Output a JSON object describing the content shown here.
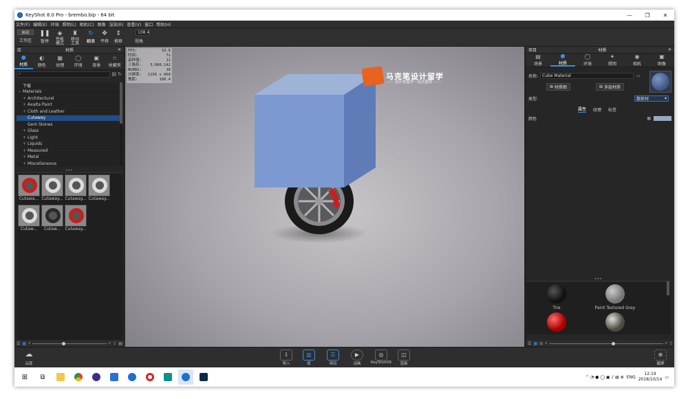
{
  "window": {
    "title": "KeyShot 8.0 Pro  -  brembo.bip  -  64 bit",
    "min": "—",
    "max": "❐",
    "close": "✕"
  },
  "menu": [
    "文件(F)",
    "编辑(E)",
    "环境",
    "照明(L)",
    "相机(C)",
    "图像",
    "渲染(R)",
    "查看(V)",
    "窗口",
    "帮助(H)"
  ],
  "toolbar": {
    "launch": "启动",
    "workspace": "工作区",
    "pause": "暂停",
    "perf_mode": "性能\n模式",
    "move_tool": "移动\n工具",
    "tumble": "翻滚",
    "pan": "平移",
    "dolly": "推移",
    "fov_value": "108.4",
    "fov_label": "视角"
  },
  "left_panel": {
    "title": "材质",
    "section": "库",
    "tabs": [
      {
        "label": "材质",
        "icon": "material-icon"
      },
      {
        "label": "颜色",
        "icon": "color-icon"
      },
      {
        "label": "纹理",
        "icon": "texture-icon"
      },
      {
        "label": "环境",
        "icon": "environment-icon"
      },
      {
        "label": "背景",
        "icon": "background-icon"
      },
      {
        "label": "收藏夹",
        "icon": "favorites-icon"
      }
    ],
    "tree": [
      {
        "label": "下载",
        "level": 0,
        "sel": false,
        "plus": ""
      },
      {
        "label": "Materials",
        "level": 0,
        "sel": false,
        "plus": "−"
      },
      {
        "label": "Architectural",
        "level": 1,
        "sel": false,
        "plus": "+"
      },
      {
        "label": "Axalta Paint",
        "level": 1,
        "sel": false,
        "plus": "+"
      },
      {
        "label": "Cloth and Leather",
        "level": 1,
        "sel": false,
        "plus": "+"
      },
      {
        "label": "Cutaway",
        "level": 1,
        "sel": true,
        "plus": ""
      },
      {
        "label": "Gem Stones",
        "level": 1,
        "sel": false,
        "plus": ""
      },
      {
        "label": "Glass",
        "level": 1,
        "sel": false,
        "plus": "+"
      },
      {
        "label": "Light",
        "level": 1,
        "sel": false,
        "plus": "+"
      },
      {
        "label": "Liquids",
        "level": 1,
        "sel": false,
        "plus": "+"
      },
      {
        "label": "Measured",
        "level": 1,
        "sel": false,
        "plus": "+"
      },
      {
        "label": "Metal",
        "level": 1,
        "sel": false,
        "plus": "+"
      },
      {
        "label": "Miscellaneous",
        "level": 1,
        "sel": false,
        "plus": "+"
      }
    ],
    "thumbnails": [
      {
        "label": "Cutawa...",
        "ring": "red"
      },
      {
        "label": "Cutaway...",
        "ring": "grey"
      },
      {
        "label": "Cutaway...",
        "ring": "grey"
      },
      {
        "label": "Cutaway...",
        "ring": "grey"
      },
      {
        "label": "Cutaw...",
        "ring": "grey"
      },
      {
        "label": "Cutaw...",
        "ring": "dark"
      },
      {
        "label": "Cutaway...",
        "ring": "red"
      }
    ]
  },
  "viewport": {
    "stats": [
      {
        "k": "FPS:",
        "v": "19.6"
      },
      {
        "k": "时间:",
        "v": "7s"
      },
      {
        "k": "采样值:",
        "v": "11"
      },
      {
        "k": "三角形:",
        "v": "3,000,142"
      },
      {
        "k": "NURBS:",
        "v": "16"
      },
      {
        "k": "分辨率:",
        "v": "1156 x 860"
      },
      {
        "k": "焦距:",
        "v": "108.4"
      }
    ],
    "watermark_title": "马克笔设计留学",
    "watermark_sub": "—— 设计类留学一站式服务 ——"
  },
  "right_panel": {
    "section": "项目",
    "title": "材质",
    "tabs": [
      {
        "label": "场景",
        "icon": "scene-icon"
      },
      {
        "label": "材质",
        "icon": "material-icon"
      },
      {
        "label": "环境",
        "icon": "environment-icon"
      },
      {
        "label": "照明",
        "icon": "lighting-icon"
      },
      {
        "label": "相机",
        "icon": "camera-icon"
      },
      {
        "label": "图像",
        "icon": "image-icon"
      }
    ],
    "name_label": "名称:",
    "name_value": "Cube Material",
    "graph_button": "材质图",
    "multi_button": "多层材质",
    "type_label": "类型:",
    "type_value": "散射材",
    "subtabs": [
      "属性",
      "纹理",
      "标签"
    ],
    "color_label": "颜色",
    "color_value": "#8ea9d6",
    "library": [
      {
        "label": "Tire",
        "color": "#111111"
      },
      {
        "label": "Paint Textured Grey",
        "color": "#7a7a7a"
      },
      {
        "label": "",
        "color": "#b01212"
      },
      {
        "label": "",
        "color": "#4a4a40"
      }
    ]
  },
  "bottom": {
    "cloud": "云库",
    "import": "导入",
    "library": "库",
    "project": "项目",
    "animation": "动画",
    "keyshotxr": "KeyShotXR",
    "render": "渲染",
    "screenshot": "截屏"
  },
  "taskbar": {
    "lang": "ENG",
    "time": "12:19",
    "date": "2018/10/14"
  }
}
